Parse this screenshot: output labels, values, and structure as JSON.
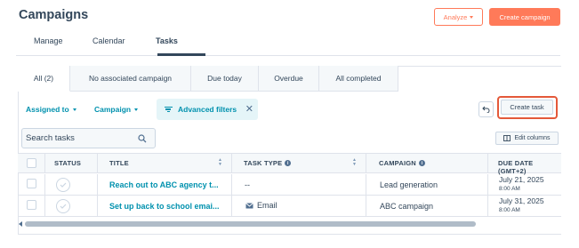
{
  "header": {
    "title": "Campaigns",
    "analyze_label": "Analyze",
    "create_campaign_label": "Create campaign"
  },
  "main_tabs": [
    {
      "label": "Manage",
      "active": false
    },
    {
      "label": "Calendar",
      "active": false
    },
    {
      "label": "Tasks",
      "active": true
    }
  ],
  "sub_tabs": [
    {
      "label": "All (2)",
      "active": true
    },
    {
      "label": "No associated campaign",
      "active": false
    },
    {
      "label": "Due today",
      "active": false
    },
    {
      "label": "Overdue",
      "active": false
    },
    {
      "label": "All completed",
      "active": false
    }
  ],
  "filters": {
    "assigned_to_label": "Assigned to",
    "campaign_label": "Campaign",
    "advanced_filters_label": "Advanced filters",
    "create_task_label": "Create task"
  },
  "search": {
    "placeholder": "Search tasks",
    "value": ""
  },
  "edit_columns_label": "Edit columns",
  "table": {
    "columns": [
      "STATUS",
      "TITLE",
      "TASK TYPE",
      "CAMPAIGN",
      "DUE DATE (GMT+2)"
    ],
    "rows": [
      {
        "title": "Reach out to ABC agency t...",
        "task_type": "--",
        "task_type_icon": "",
        "campaign": "Lead generation",
        "due_date": "July 21, 2025",
        "due_time": "8:00 AM"
      },
      {
        "title": "Set up back to school emai...",
        "task_type": "Email",
        "task_type_icon": "email-icon",
        "campaign": "ABC campaign",
        "due_date": "July 31, 2025",
        "due_time": "8:00 AM"
      }
    ]
  },
  "colors": {
    "accent": "#ff7a59",
    "link": "#0091ae",
    "text": "#33475b",
    "highlight_outline": "#e4593a"
  }
}
